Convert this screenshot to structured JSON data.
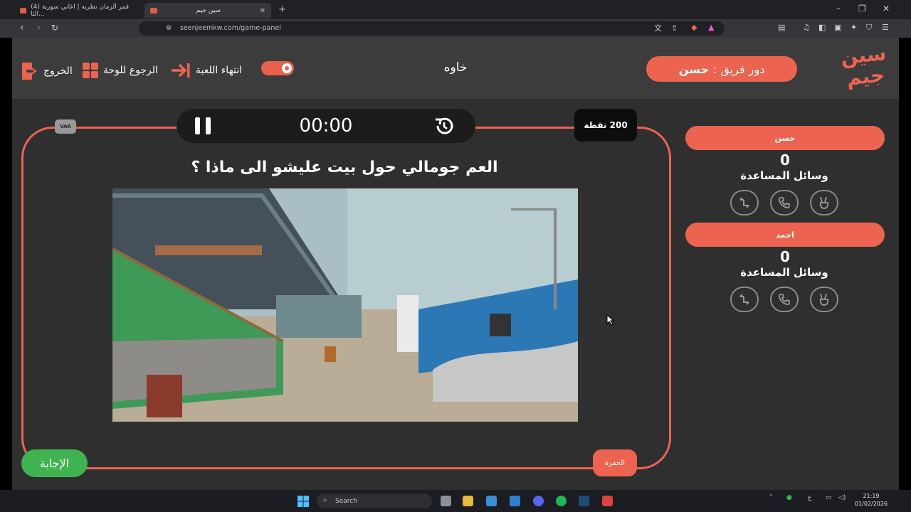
{
  "browser": {
    "tabs": [
      {
        "title": "(4) قمر الزمان بطريه | اغاني سورية الثا...",
        "active": false
      },
      {
        "title": "سين جيم",
        "active": true
      }
    ],
    "url": "seenjeemkw.com/game-panel"
  },
  "header": {
    "exit_label": "الخروج",
    "back_label": "الرجوع للوحة",
    "end_game_label": "انتهاء اللعبة",
    "category": "خاوه",
    "turn_prefix": "دور فريق :",
    "turn_team": "حسن",
    "logo_text": "سين جيم"
  },
  "question_panel": {
    "timer": "00:00",
    "points": "200 نقطة",
    "var_label": "VAR",
    "question": "العم جومالي حول بيت عليشو الى ماذا ؟",
    "answer_label": "الإجابة",
    "hole_label": "الحفرة"
  },
  "teams": [
    {
      "name": "حسن",
      "score": "0",
      "aids_label": "وسائل المساعدة",
      "aids": [
        "two-answers-icon",
        "call-friend-icon",
        "swap-turn-icon"
      ]
    },
    {
      "name": "احمد",
      "score": "0",
      "aids_label": "وسائل المساعدة",
      "aids": [
        "two-answers-icon",
        "call-friend-icon",
        "swap-turn-icon"
      ]
    }
  ],
  "taskbar": {
    "search_placeholder": "Search",
    "time": "21:19",
    "date": "01/02/2026",
    "lang": "ع"
  },
  "colors": {
    "accent": "#ec6450",
    "answer": "#3fb34f",
    "panel_bg": "#2f2f2f",
    "header_bg": "#3c3c3c"
  }
}
